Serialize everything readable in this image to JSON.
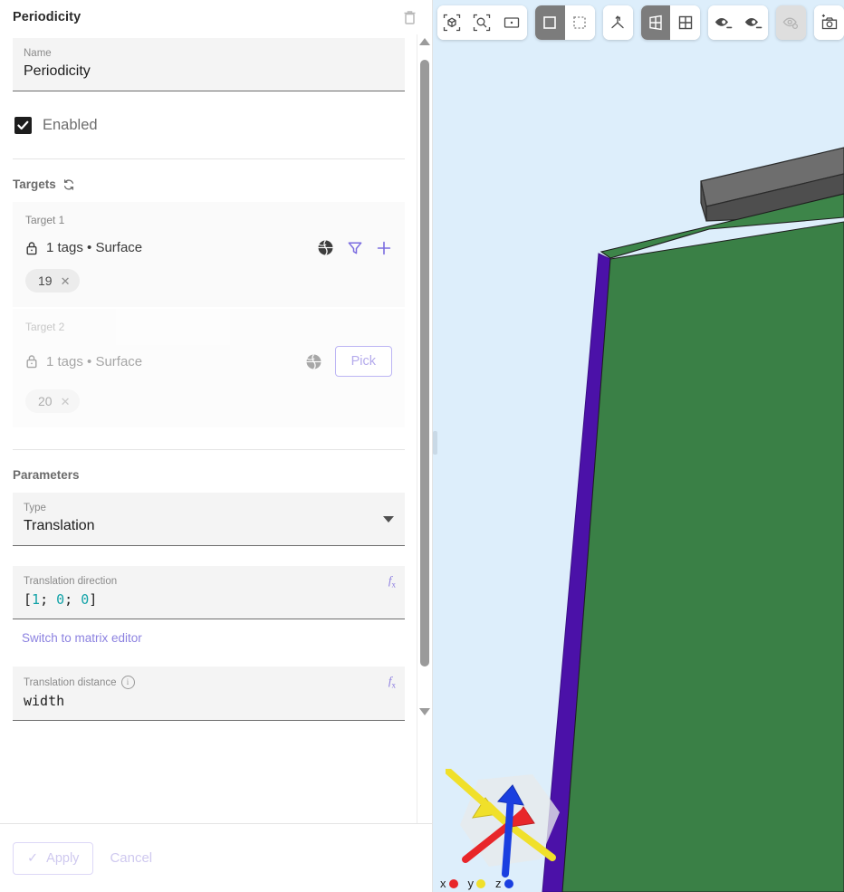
{
  "panel": {
    "title": "Periodicity",
    "delete_icon": "trash-icon",
    "name_field": {
      "label": "Name",
      "value": "Periodicity"
    },
    "enabled": {
      "label": "Enabled",
      "checked": true,
      "check_glyph": "✔"
    },
    "targets": {
      "heading": "Targets",
      "refresh_icon": "refresh-icon",
      "items": [
        {
          "title": "Target 1",
          "lock_icon": "lock-icon",
          "description": "1 tags • Surface",
          "globe_icon": "globe-icon",
          "filter_icon": "filter-icon",
          "add_icon": "plus-icon",
          "chips": [
            {
              "label": "19",
              "remove": "✕"
            }
          ],
          "disabled": false,
          "has_pick": false
        },
        {
          "title": "Target 2",
          "lock_icon": "lock-icon",
          "description": "1 tags • Surface",
          "globe_icon": "globe-icon",
          "pick_label": "Pick",
          "chips": [
            {
              "label": "20",
              "remove": "✕"
            }
          ],
          "disabled": true,
          "has_pick": true
        }
      ]
    },
    "parameters": {
      "heading": "Parameters",
      "type_field": {
        "label": "Type",
        "value": "Translation",
        "caret_icon": "chevron-down-icon",
        "options": [
          "Translation"
        ]
      },
      "translation_direction": {
        "label": "Translation direction",
        "fx_label": "f",
        "fx_sub": "x",
        "code": {
          "open": "[",
          "v1": "1",
          "sep1": "; ",
          "v2": "0",
          "sep2": "; ",
          "v3": "0",
          "close": "]"
        },
        "raw_value": "[1; 0; 0]"
      },
      "matrix_editor_link": "Switch to matrix editor",
      "translation_distance": {
        "label": "Translation distance",
        "info_icon": "info-icon",
        "info_glyph": "i",
        "fx_label": "f",
        "fx_sub": "x",
        "value": "width"
      }
    },
    "footer": {
      "apply_label": "Apply",
      "apply_check": "✓",
      "cancel_label": "Cancel",
      "apply_enabled": false
    },
    "scrollbar": {
      "up_icon": "scroll-up-arrow",
      "down_icon": "scroll-down-arrow"
    }
  },
  "viewport": {
    "splitter": "panel-splitter-handle",
    "background_color": "#ddeefb",
    "toolbar": {
      "groups": [
        {
          "name": "view-fit-group",
          "buttons": [
            {
              "name": "fit-to-selection-icon",
              "state": "normal"
            },
            {
              "name": "zoom-to-region-icon",
              "state": "normal"
            },
            {
              "name": "fit-all-icon",
              "state": "normal"
            }
          ]
        },
        {
          "name": "selection-mode-group",
          "buttons": [
            {
              "name": "rectangle-select-icon",
              "state": "active"
            },
            {
              "name": "marquee-select-icon",
              "state": "normal"
            }
          ]
        },
        {
          "name": "axes-group",
          "buttons": [
            {
              "name": "axes-triad-icon",
              "state": "normal"
            }
          ]
        },
        {
          "name": "display-mode-group",
          "buttons": [
            {
              "name": "perspective-view-icon",
              "state": "active"
            },
            {
              "name": "grid-view-icon",
              "state": "normal"
            }
          ]
        },
        {
          "name": "visibility-group",
          "buttons": [
            {
              "name": "show-entity-icon",
              "state": "normal"
            },
            {
              "name": "hide-entity-icon",
              "state": "normal"
            }
          ]
        },
        {
          "name": "hidden-toggle-group",
          "buttons": [
            {
              "name": "show-hidden-icon",
              "state": "disabled"
            }
          ]
        },
        {
          "name": "screenshot-group",
          "buttons": [
            {
              "name": "capture-screenshot-icon",
              "state": "normal"
            }
          ]
        }
      ]
    },
    "axis_widget": {
      "name": "navigation-cube",
      "legend": [
        {
          "label": "x",
          "color": "#e8262a"
        },
        {
          "label": "y",
          "color": "#f0e02a"
        },
        {
          "label": "z",
          "color": "#1a3fe0"
        }
      ]
    },
    "model": {
      "surface_color": "#3a8046",
      "highlight_edge_color": "#4b11a8",
      "bar_color": "#5b5b5b",
      "bar_top_color": "#6e6e6e",
      "bar_side_color": "#4a4a4a"
    }
  }
}
